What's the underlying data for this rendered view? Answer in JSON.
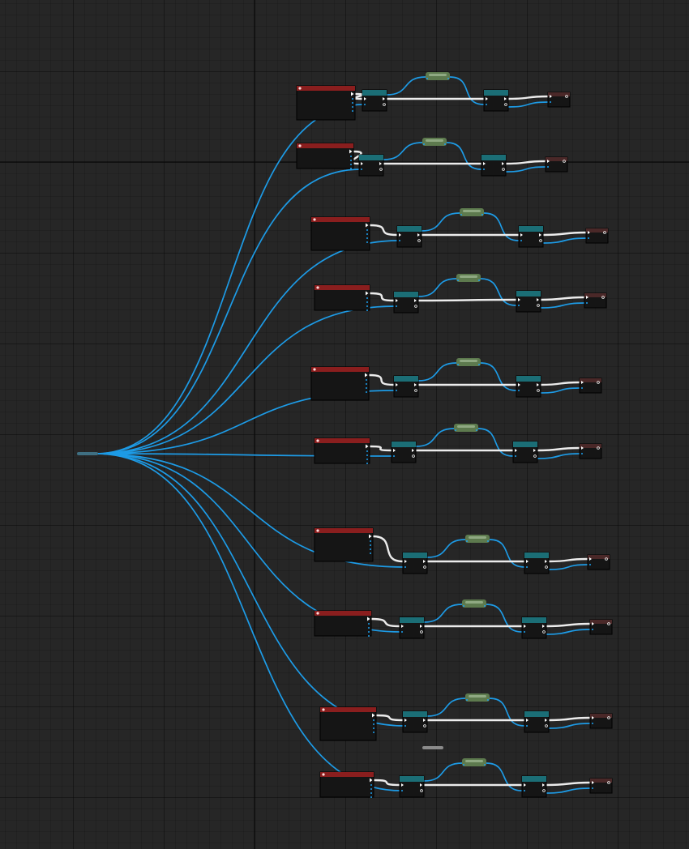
{
  "editor": {
    "accent_colors": {
      "data_wire": "#1d9be6",
      "exec_wire": "#ececec",
      "event_header": "#8a1e1e",
      "function_header": "#1b6e76",
      "pure_header": "#5d7a4e",
      "end_header": "#4a2828"
    },
    "source_node": {
      "icon": "reroute-icon"
    },
    "chains_count": 10,
    "node_types": [
      "event-node",
      "function-node",
      "pure-node",
      "output-node"
    ]
  }
}
